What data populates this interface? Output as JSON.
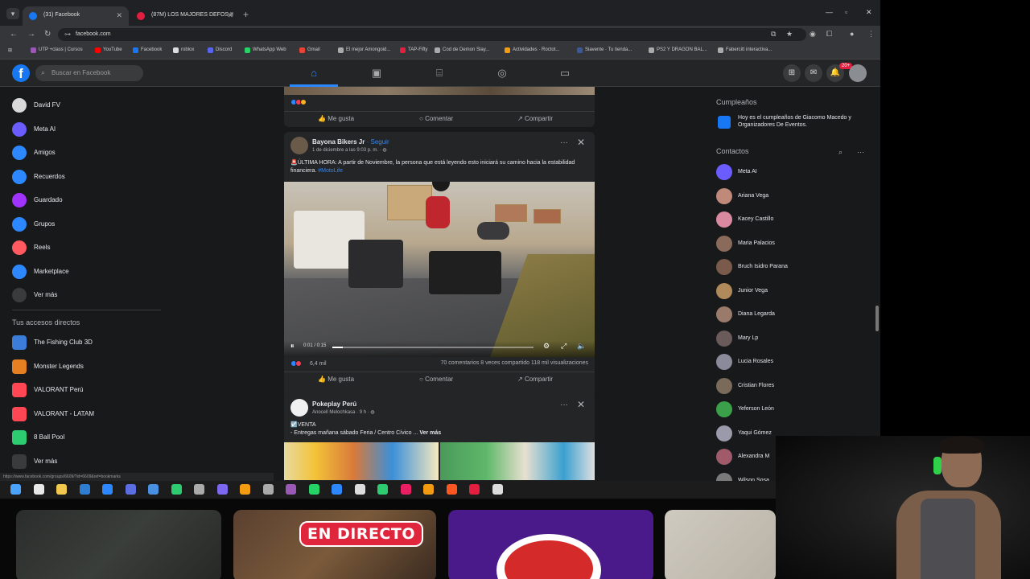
{
  "browser": {
    "tabs": [
      {
        "title": "(31) Facebook",
        "active": true,
        "favicon_color": "#1877f2"
      },
      {
        "title": "(87M) LOS MAJORES DEFOS II",
        "active": false,
        "favicon_color": "#e41e3f"
      }
    ],
    "url": "facebook.com",
    "bookmarks": [
      {
        "label": "UTP +class | Cursos",
        "color": "#9b59b6"
      },
      {
        "label": "YouTube",
        "color": "#ff0000"
      },
      {
        "label": "Facebook",
        "color": "#1877f2"
      },
      {
        "label": "roblox",
        "color": "#dddddd"
      },
      {
        "label": "Discord",
        "color": "#5865f2"
      },
      {
        "label": "WhatsApp Web",
        "color": "#25d366"
      },
      {
        "label": "Gmail",
        "color": "#ea4335"
      },
      {
        "label": "El mejor Amongoid...",
        "color": "#aaaaaa"
      },
      {
        "label": "TAP-Fifty",
        "color": "#e41e3f"
      },
      {
        "label": "Cod de Demon Slay...",
        "color": "#aaaaaa"
      },
      {
        "label": "Actividades · Roctot...",
        "color": "#f39c12"
      },
      {
        "label": "Siavente · Tu tienda...",
        "color": "#3b5998"
      },
      {
        "label": "PS2 Y DRAGON BAL...",
        "color": "#aaaaaa"
      },
      {
        "label": "Fabercitt interactiva...",
        "color": "#aaaaaa"
      }
    ]
  },
  "fb": {
    "search_placeholder": "Buscar en Facebook",
    "notif_count": "20+"
  },
  "left_menu": [
    {
      "label": "David FV",
      "color": "#d9d9d9"
    },
    {
      "label": "Meta AI",
      "color": "#6a5cff"
    },
    {
      "label": "Amigos",
      "color": "#2d88ff"
    },
    {
      "label": "Recuerdos",
      "color": "#2d88ff"
    },
    {
      "label": "Guardado",
      "color": "#a033ff"
    },
    {
      "label": "Grupos",
      "color": "#2d88ff"
    },
    {
      "label": "Reels",
      "color": "#ff5a5f"
    },
    {
      "label": "Marketplace",
      "color": "#2d88ff"
    },
    {
      "label": "Ver más",
      "color": "#3a3b3c"
    }
  ],
  "shortcuts": {
    "title": "Tus accesos directos",
    "items": [
      {
        "label": "The Fishing Club 3D",
        "color": "#3b7dd8"
      },
      {
        "label": "Monster Legends",
        "color": "#e67e22"
      },
      {
        "label": "VALORANT Perú",
        "color": "#ff4655"
      },
      {
        "label": "VALORANT - LATAM",
        "color": "#ff4655"
      },
      {
        "label": "8 Ball Pool",
        "color": "#2ecc71"
      },
      {
        "label": "Ver más",
        "color": "#3a3b3c"
      }
    ]
  },
  "post_top": {
    "actions": [
      "Me gusta",
      "Comentar",
      "Compartir"
    ]
  },
  "post_main": {
    "page": "Bayona Bikers Jr",
    "follow": "· Seguir",
    "meta": "1 de diciembre a las 9:03 p. m. · ",
    "text": "🚨ÚLTIMA HORA: A partir de Noviembre, la persona que está leyendo esto iniciará su camino hacia la estabilidad financiera.",
    "hashtag": "#MotoLife",
    "video_time": "0:01 / 0:15",
    "video_progress": 0.05,
    "reaction_count": "6,4 mil",
    "stats": "70 comentarios   8 veces compartido   118 mil visualizaciones",
    "actions": [
      "Me gusta",
      "Comentar",
      "Compartir"
    ]
  },
  "post_next": {
    "page": "Pokeplay Perú",
    "meta": "Anocell Melochkasa · 9 h · ",
    "text": "☑️VENTA",
    "text2": "- Entregas mañana sábado Feria / Centro Cívico ...",
    "more": "Ver más"
  },
  "right": {
    "birthdays_title": "Cumpleaños",
    "birthday_text": "Hoy es el cumpleaños de Giacomo Macedo y Organizadores De Eventos.",
    "contacts_title": "Contactos",
    "contacts": [
      {
        "name": "Meta AI",
        "color": "#6a5cff"
      },
      {
        "name": "Ariana Vega",
        "color": "#c08a7a"
      },
      {
        "name": "Kacey Castillo",
        "color": "#d98aa0"
      },
      {
        "name": "Maria Palacios",
        "color": "#8a6a5a"
      },
      {
        "name": "Bruch Isidro Parana",
        "color": "#7a5a4a"
      },
      {
        "name": "Junior Vega",
        "color": "#b08a5a"
      },
      {
        "name": "Diana Legarda",
        "color": "#9a7a6a"
      },
      {
        "name": "Mary Lp",
        "color": "#6a5a5a"
      },
      {
        "name": "Lucia Rosales",
        "color": "#8a8a9a"
      },
      {
        "name": "Cristian Flores",
        "color": "#7a6a5a"
      },
      {
        "name": "Yeferson León",
        "color": "#3aa04a"
      },
      {
        "name": "Yaqui Gómez",
        "color": "#9a9aaa"
      },
      {
        "name": "Alexandra M",
        "color": "#a05a6a"
      },
      {
        "name": "Wilson Sosa",
        "color": "#7a7a7a"
      }
    ]
  },
  "status_url": "https://www.facebook.com/groups/6609/?id=6609&ref=bookmarks",
  "stream": {
    "live_label": "EN DIRECTO"
  }
}
